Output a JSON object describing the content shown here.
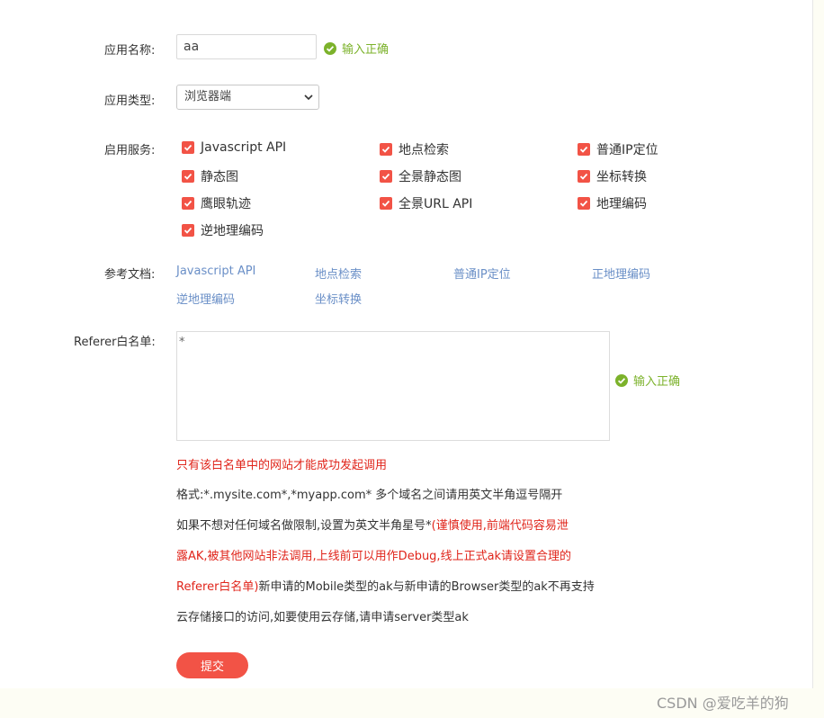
{
  "form": {
    "app_name_label": "应用名称:",
    "app_name_value": "aa",
    "app_name_valid": "输入正确",
    "app_type_label": "应用类型:",
    "app_type_value": "浏览器端",
    "services_label": "启用服务:",
    "services": [
      "Javascript API",
      "地点检索",
      "普通IP定位",
      "静态图",
      "全景静态图",
      "坐标转换",
      "鹰眼轨迹",
      "全景URL API",
      "地理编码",
      "逆地理编码"
    ],
    "docs_label": "参考文档:",
    "docs": [
      "Javascript API",
      "地点检索",
      "普通IP定位",
      "正地理编码",
      "逆地理编码",
      "坐标转换"
    ],
    "referer_label": "Referer白名单:",
    "referer_value": "*",
    "referer_valid": "输入正确",
    "notes": {
      "line1": "只有该白名单中的网站才能成功发起调用",
      "line2": "格式:*.mysite.com*,*myapp.com* 多个域名之间请用英文半角逗号隔开",
      "line3_dark": "如果不想对任何域名做限制,设置为英文半角星号*",
      "line3_red": "(谨慎使用,前端代码容易泄",
      "line4_red": "露AK,被其他网站非法调用,上线前可以用作Debug,线上正式ak请设置合理的",
      "line5_red": "Referer白名单)",
      "line5_dark": "新申请的Mobile类型的ak与新申请的Browser类型的ak不再支持",
      "line6": "云存储接口的访问,如要使用云存储,请申请server类型ak"
    },
    "submit_label": "提交"
  },
  "watermark": "CSDN @爱吃羊的狗",
  "colors": {
    "accent": "#f25346",
    "valid": "#7cb22b",
    "link": "#6a8fc7",
    "warn": "#e0251b"
  }
}
